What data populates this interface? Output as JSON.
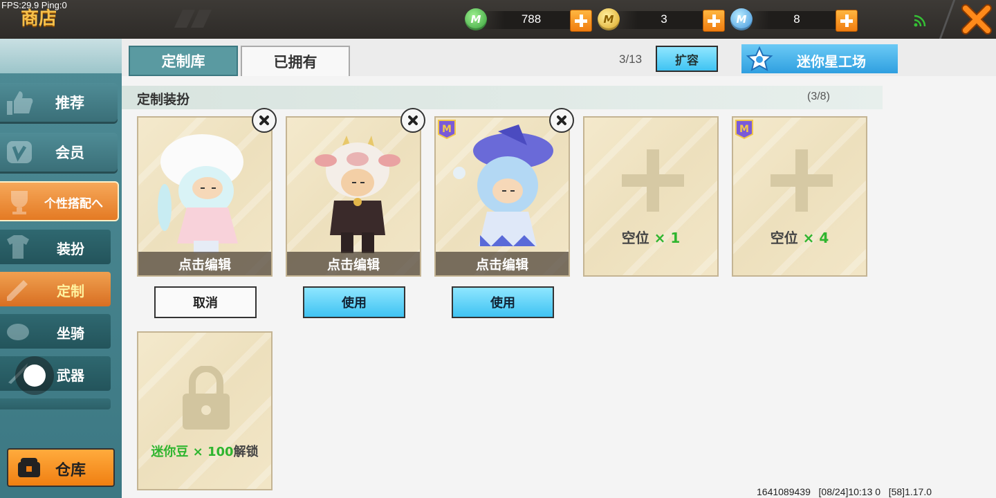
{
  "status": {
    "fps": "FPS:29.9  Ping:0"
  },
  "header": {
    "title": "商店"
  },
  "currencies": [
    {
      "name": "mini-bean",
      "icon": "green-gem-icon",
      "color": "#4cb84a",
      "value": "788"
    },
    {
      "name": "mini-coin",
      "icon": "gold-m-coin-icon",
      "color": "#e8b92a",
      "value": "3"
    },
    {
      "name": "mini-point",
      "icon": "blue-m-coin-icon",
      "color": "#4aa8e8",
      "value": "8"
    }
  ],
  "sidebar": {
    "items": [
      {
        "label": "推荐"
      },
      {
        "label": "会员"
      },
      {
        "label": "个性搭配へ"
      },
      {
        "label": "装扮"
      },
      {
        "label": "定制"
      },
      {
        "label": "坐骑"
      },
      {
        "label": "武器"
      }
    ],
    "warehouse": "仓库"
  },
  "tabs": [
    {
      "label": "定制库"
    },
    {
      "label": "已拥有"
    }
  ],
  "toolbar": {
    "capacity": "3/13",
    "expand": "扩容",
    "workshop": "迷你星工场"
  },
  "section": {
    "title": "定制装扮",
    "count": "(3/8)"
  },
  "cards": {
    "edit_label": "点击编辑",
    "slot1": {
      "prefix": "空位 ",
      "count": "× 1"
    },
    "slot2": {
      "prefix": "空位 ",
      "count": "× 4"
    },
    "locked": {
      "price": "迷你豆 × 100",
      "suffix": "解锁"
    }
  },
  "actions": {
    "cancel": "取消",
    "use": "使用"
  },
  "footer": {
    "info": "1641089439   [08/24]10:13 0   [58]1.17.0"
  }
}
